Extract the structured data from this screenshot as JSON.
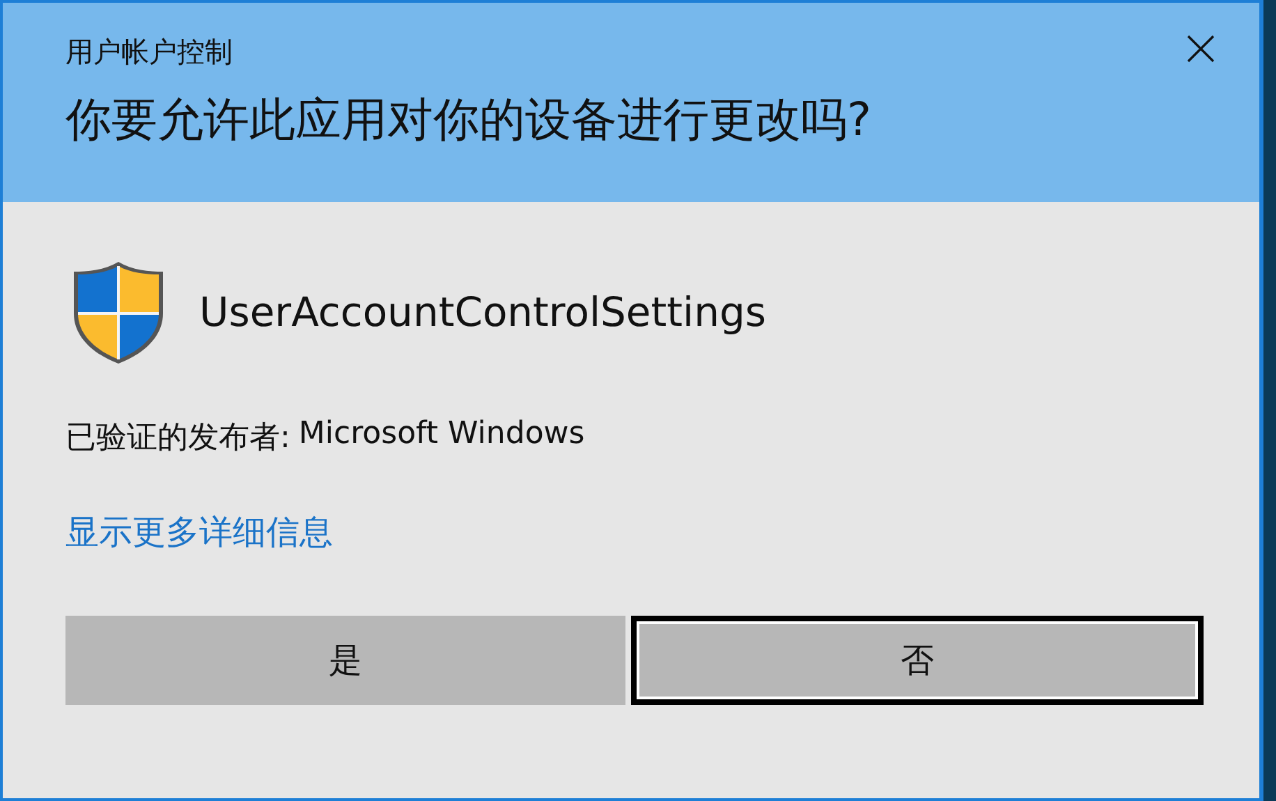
{
  "window": {
    "title": "用户帐户控制",
    "question": "你要允许此应用对你的设备进行更改吗?"
  },
  "app": {
    "name": "UserAccountControlSettings"
  },
  "publisher": {
    "label": "已验证的发布者:",
    "value": "Microsoft Windows"
  },
  "details_link": "显示更多详细信息",
  "buttons": [
    {
      "label": "是",
      "focused": false
    },
    {
      "label": "否",
      "focused": true
    }
  ]
}
